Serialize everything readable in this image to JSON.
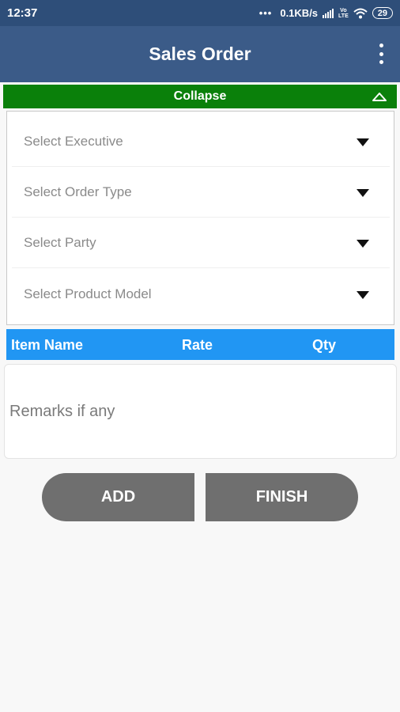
{
  "status_bar": {
    "time": "12:37",
    "dots": "•••",
    "network_speed": "0.1KB/s",
    "volte_top": "Vo",
    "volte_bottom": "LTE",
    "battery": "29"
  },
  "app_bar": {
    "title": "Sales Order",
    "menu_icon": "more-vert-icon"
  },
  "collapse": {
    "label": "Collapse",
    "icon": "triangle-up-icon"
  },
  "dropdowns": [
    {
      "placeholder": "Select Executive"
    },
    {
      "placeholder": "Select Order Type"
    },
    {
      "placeholder": "Select Party"
    },
    {
      "placeholder": "Select Product Model"
    }
  ],
  "table": {
    "columns": [
      "Item Name",
      "Rate",
      "Qty"
    ]
  },
  "remarks": {
    "placeholder": "Remarks if any",
    "value": ""
  },
  "buttons": {
    "add": "ADD",
    "finish": "FINISH"
  },
  "colors": {
    "status_bar": "#2e4e79",
    "app_bar": "#3b5b88",
    "collapse_bar": "#0a800a",
    "table_header": "#2196f3",
    "button": "#6f6f6f"
  }
}
